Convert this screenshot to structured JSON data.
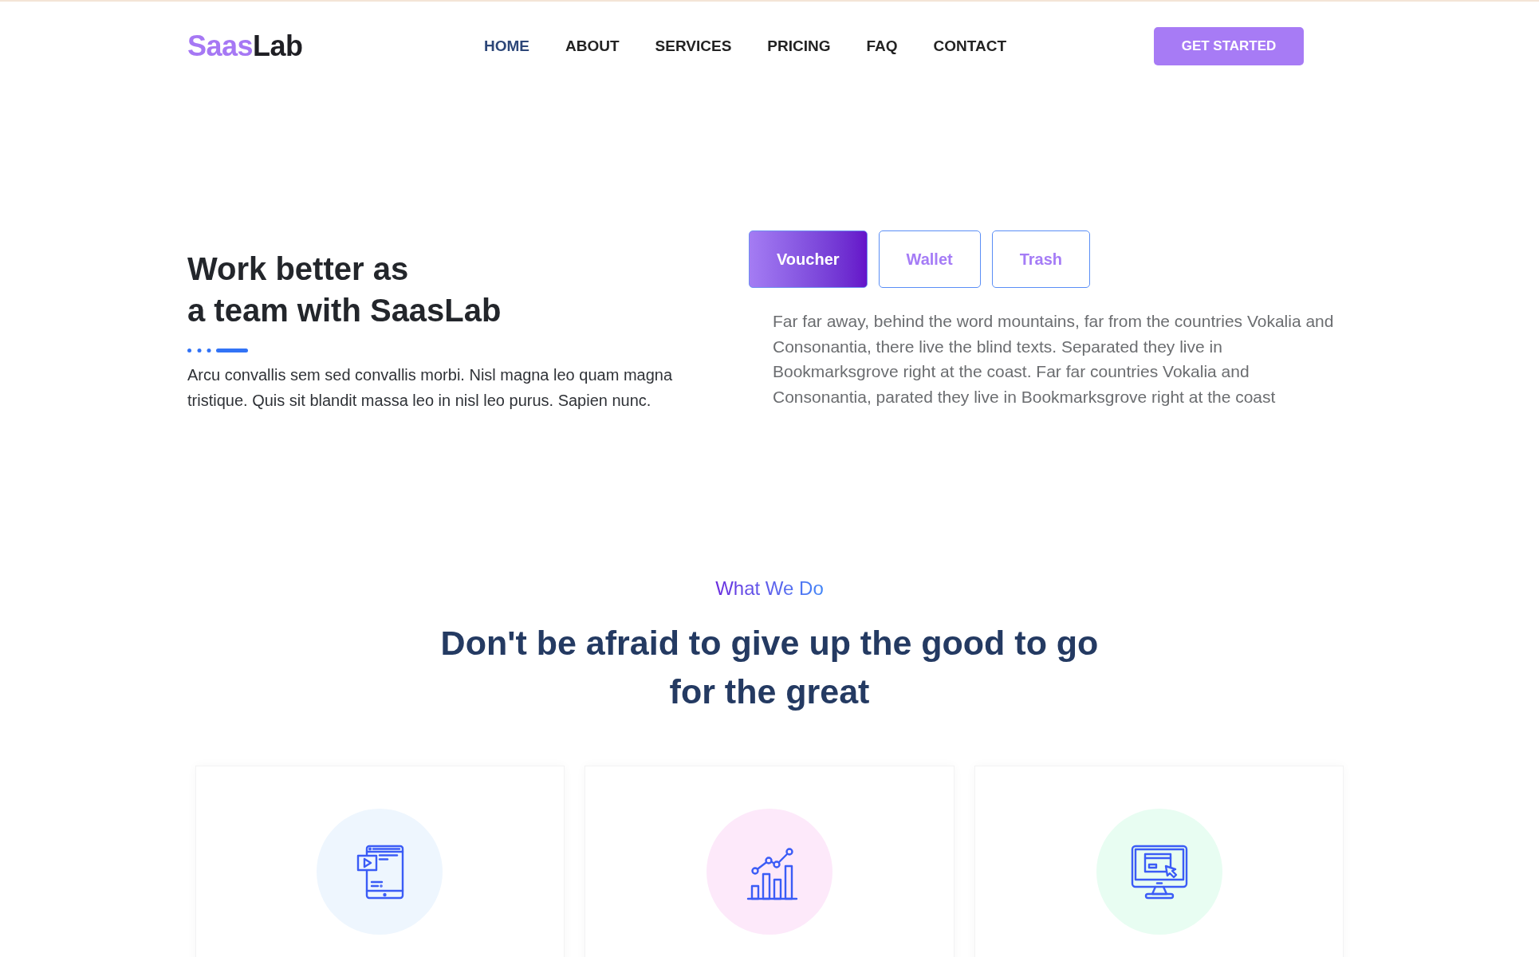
{
  "header": {
    "logo": {
      "highlight": "Saas",
      "text": "Lab"
    },
    "nav": [
      {
        "label": "HOME",
        "selected": true
      },
      {
        "label": "ABOUT",
        "selected": false
      },
      {
        "label": "SERVICES",
        "selected": false
      },
      {
        "label": "PRICING",
        "selected": false
      },
      {
        "label": "FAQ",
        "selected": false
      },
      {
        "label": "CONTACT",
        "selected": false
      }
    ],
    "cta": "GET STARTED"
  },
  "hero": {
    "title": "Work better as\na team with SaasLab",
    "text": "Arcu convallis sem sed convallis morbi. Nisl magna leo quam magna tristique. Quis sit blandit massa leo in nisl leo purus. Sapien nunc.",
    "tabs": [
      {
        "label": "Voucher",
        "selected": true
      },
      {
        "label": "Wallet",
        "selected": false
      },
      {
        "label": "Trash",
        "selected": false
      }
    ],
    "tab_text": "Far far away, behind the word mountains, far from the countries Vokalia and Consonantia, there live the blind texts. Separated they live in Bookmarksgrove right at the coast. Far far countries Vokalia and Consonantia, parated they live in Bookmarksgrove right at the coast"
  },
  "services": {
    "label": "What We Do",
    "title": "Don't be afraid to give up the good to go for the great",
    "cards": [
      {
        "color": "#eef6fe"
      },
      {
        "color": "#fde9fa"
      },
      {
        "color": "#e8fdf2"
      }
    ]
  }
}
